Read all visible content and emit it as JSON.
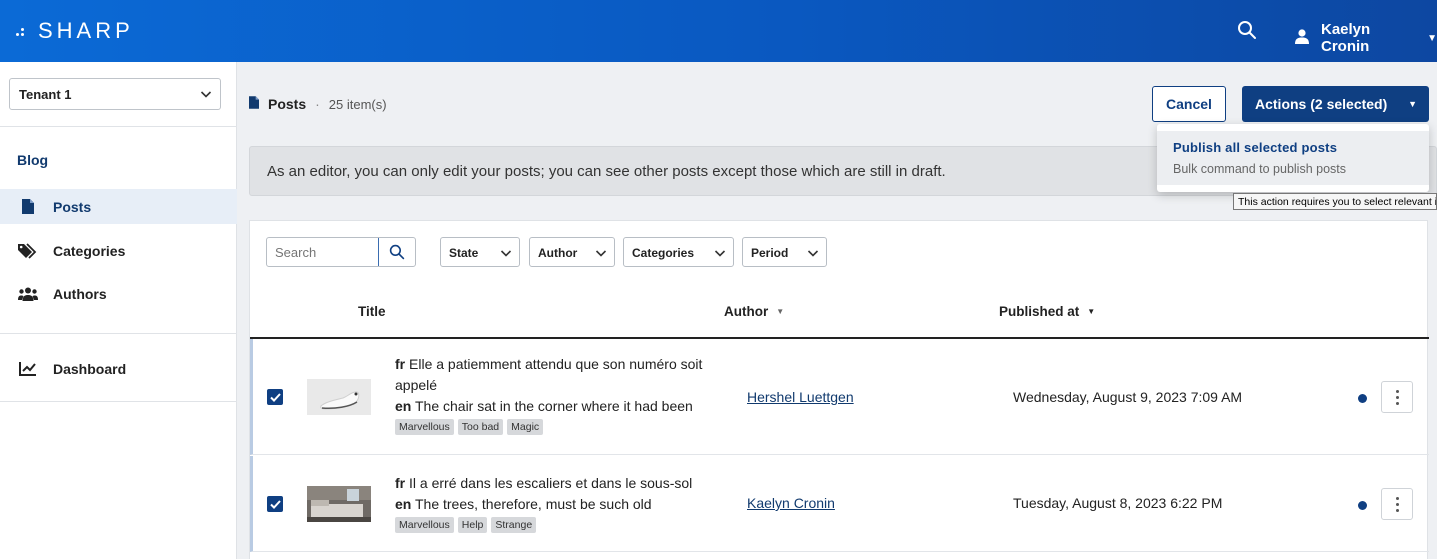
{
  "app": {
    "logo": "SHARP"
  },
  "user": {
    "name": "Kaelyn Cronin"
  },
  "sidebar": {
    "tenant": "Tenant 1",
    "section": "Blog",
    "items": [
      {
        "label": "Posts",
        "icon": "file-icon",
        "active": true
      },
      {
        "label": "Categories",
        "icon": "tags-icon",
        "active": false
      },
      {
        "label": "Authors",
        "icon": "users-icon",
        "active": false
      },
      {
        "label": "Dashboard",
        "icon": "chart-line-icon",
        "active": false
      }
    ]
  },
  "header": {
    "title": "Posts",
    "separator": "·",
    "count": "25 item(s)",
    "cancel_label": "Cancel",
    "actions_label": "Actions (2 selected)"
  },
  "dropdown": {
    "title": "Publish all selected posts",
    "subtitle": "Bulk command to publish posts"
  },
  "tooltip": "This action requires you to select relevant items",
  "alert": "As an editor, you can only edit your posts; you can see other posts except those which are still in draft.",
  "filters": {
    "search_placeholder": "Search",
    "state": "State",
    "author": "Author",
    "categories": "Categories",
    "period": "Period"
  },
  "table": {
    "columns": {
      "title": "Title",
      "author": "Author",
      "published": "Published at"
    },
    "rows": [
      {
        "fr_label": "fr",
        "fr": "Elle a patiemment attendu que son numéro soit appelé",
        "en_label": "en",
        "en": "The chair sat in the corner where it had been",
        "tags": [
          "Marvellous",
          "Too bad",
          "Magic"
        ],
        "author": "Hershel Luettgen",
        "published": "Wednesday, August 9, 2023 7:09 AM",
        "selected": true
      },
      {
        "fr_label": "fr",
        "fr": "Il a erré dans les escaliers et dans le sous-sol",
        "en_label": "en",
        "en": "The trees, therefore, must be such old",
        "tags": [
          "Marvellous",
          "Help",
          "Strange"
        ],
        "author": "Kaelyn Cronin",
        "published": "Tuesday, August 8, 2023 6:22 PM",
        "selected": true
      }
    ]
  },
  "colors": {
    "primary": "#0f3f82",
    "topbar": "#0a58c0",
    "background": "#eef0f3"
  }
}
